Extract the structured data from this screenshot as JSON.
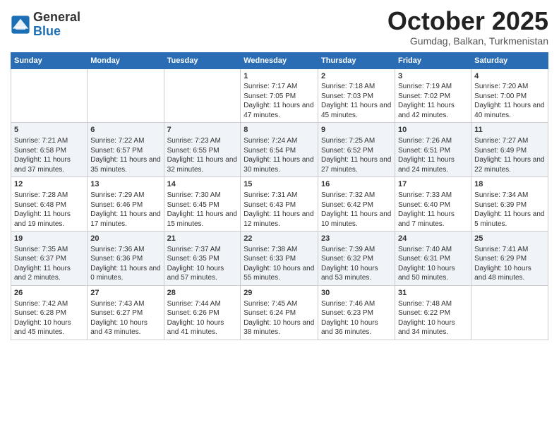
{
  "logo": {
    "general": "General",
    "blue": "Blue"
  },
  "title": "October 2025",
  "subtitle": "Gumdag, Balkan, Turkmenistan",
  "days_of_week": [
    "Sunday",
    "Monday",
    "Tuesday",
    "Wednesday",
    "Thursday",
    "Friday",
    "Saturday"
  ],
  "weeks": [
    [
      {
        "day": "",
        "info": ""
      },
      {
        "day": "",
        "info": ""
      },
      {
        "day": "",
        "info": ""
      },
      {
        "day": "1",
        "info": "Sunrise: 7:17 AM\nSunset: 7:05 PM\nDaylight: 11 hours and 47 minutes."
      },
      {
        "day": "2",
        "info": "Sunrise: 7:18 AM\nSunset: 7:03 PM\nDaylight: 11 hours and 45 minutes."
      },
      {
        "day": "3",
        "info": "Sunrise: 7:19 AM\nSunset: 7:02 PM\nDaylight: 11 hours and 42 minutes."
      },
      {
        "day": "4",
        "info": "Sunrise: 7:20 AM\nSunset: 7:00 PM\nDaylight: 11 hours and 40 minutes."
      }
    ],
    [
      {
        "day": "5",
        "info": "Sunrise: 7:21 AM\nSunset: 6:58 PM\nDaylight: 11 hours and 37 minutes."
      },
      {
        "day": "6",
        "info": "Sunrise: 7:22 AM\nSunset: 6:57 PM\nDaylight: 11 hours and 35 minutes."
      },
      {
        "day": "7",
        "info": "Sunrise: 7:23 AM\nSunset: 6:55 PM\nDaylight: 11 hours and 32 minutes."
      },
      {
        "day": "8",
        "info": "Sunrise: 7:24 AM\nSunset: 6:54 PM\nDaylight: 11 hours and 30 minutes."
      },
      {
        "day": "9",
        "info": "Sunrise: 7:25 AM\nSunset: 6:52 PM\nDaylight: 11 hours and 27 minutes."
      },
      {
        "day": "10",
        "info": "Sunrise: 7:26 AM\nSunset: 6:51 PM\nDaylight: 11 hours and 24 minutes."
      },
      {
        "day": "11",
        "info": "Sunrise: 7:27 AM\nSunset: 6:49 PM\nDaylight: 11 hours and 22 minutes."
      }
    ],
    [
      {
        "day": "12",
        "info": "Sunrise: 7:28 AM\nSunset: 6:48 PM\nDaylight: 11 hours and 19 minutes."
      },
      {
        "day": "13",
        "info": "Sunrise: 7:29 AM\nSunset: 6:46 PM\nDaylight: 11 hours and 17 minutes."
      },
      {
        "day": "14",
        "info": "Sunrise: 7:30 AM\nSunset: 6:45 PM\nDaylight: 11 hours and 15 minutes."
      },
      {
        "day": "15",
        "info": "Sunrise: 7:31 AM\nSunset: 6:43 PM\nDaylight: 11 hours and 12 minutes."
      },
      {
        "day": "16",
        "info": "Sunrise: 7:32 AM\nSunset: 6:42 PM\nDaylight: 11 hours and 10 minutes."
      },
      {
        "day": "17",
        "info": "Sunrise: 7:33 AM\nSunset: 6:40 PM\nDaylight: 11 hours and 7 minutes."
      },
      {
        "day": "18",
        "info": "Sunrise: 7:34 AM\nSunset: 6:39 PM\nDaylight: 11 hours and 5 minutes."
      }
    ],
    [
      {
        "day": "19",
        "info": "Sunrise: 7:35 AM\nSunset: 6:37 PM\nDaylight: 11 hours and 2 minutes."
      },
      {
        "day": "20",
        "info": "Sunrise: 7:36 AM\nSunset: 6:36 PM\nDaylight: 11 hours and 0 minutes."
      },
      {
        "day": "21",
        "info": "Sunrise: 7:37 AM\nSunset: 6:35 PM\nDaylight: 10 hours and 57 minutes."
      },
      {
        "day": "22",
        "info": "Sunrise: 7:38 AM\nSunset: 6:33 PM\nDaylight: 10 hours and 55 minutes."
      },
      {
        "day": "23",
        "info": "Sunrise: 7:39 AM\nSunset: 6:32 PM\nDaylight: 10 hours and 53 minutes."
      },
      {
        "day": "24",
        "info": "Sunrise: 7:40 AM\nSunset: 6:31 PM\nDaylight: 10 hours and 50 minutes."
      },
      {
        "day": "25",
        "info": "Sunrise: 7:41 AM\nSunset: 6:29 PM\nDaylight: 10 hours and 48 minutes."
      }
    ],
    [
      {
        "day": "26",
        "info": "Sunrise: 7:42 AM\nSunset: 6:28 PM\nDaylight: 10 hours and 45 minutes."
      },
      {
        "day": "27",
        "info": "Sunrise: 7:43 AM\nSunset: 6:27 PM\nDaylight: 10 hours and 43 minutes."
      },
      {
        "day": "28",
        "info": "Sunrise: 7:44 AM\nSunset: 6:26 PM\nDaylight: 10 hours and 41 minutes."
      },
      {
        "day": "29",
        "info": "Sunrise: 7:45 AM\nSunset: 6:24 PM\nDaylight: 10 hours and 38 minutes."
      },
      {
        "day": "30",
        "info": "Sunrise: 7:46 AM\nSunset: 6:23 PM\nDaylight: 10 hours and 36 minutes."
      },
      {
        "day": "31",
        "info": "Sunrise: 7:48 AM\nSunset: 6:22 PM\nDaylight: 10 hours and 34 minutes."
      },
      {
        "day": "",
        "info": ""
      }
    ]
  ]
}
